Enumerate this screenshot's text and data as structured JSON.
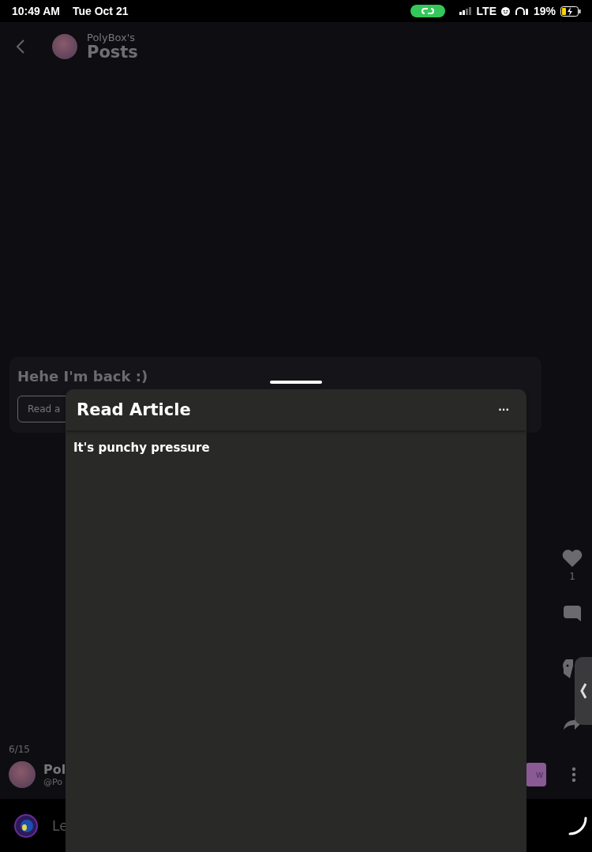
{
  "status_bar": {
    "time": "10:49 AM",
    "date": "Tue Oct 21",
    "network": "LTE",
    "battery": "19%"
  },
  "header": {
    "owner": "PolyBox's",
    "title": "Posts"
  },
  "post": {
    "text": "Hehe I'm back :)",
    "button": "Read a"
  },
  "actions": {
    "likes": "1"
  },
  "pager": "6/15",
  "author": {
    "name": "Pol",
    "handle": "@Po",
    "follow": "w"
  },
  "comment": {
    "placeholder": "Le"
  },
  "sheet": {
    "title": "Read Article",
    "menu": "···",
    "body": "It's punchy pressure"
  }
}
